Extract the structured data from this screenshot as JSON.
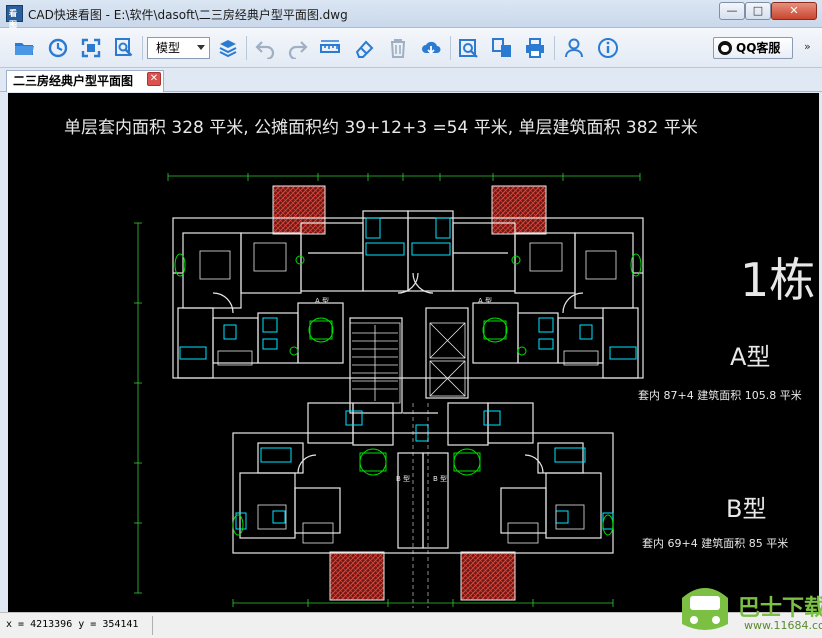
{
  "window": {
    "title": "CAD快速看图 - E:\\软件\\dasoft\\二三房经典户型平面图.dwg",
    "app_icon_text": "看图",
    "minimize": "—",
    "maximize": "□",
    "close": "✕"
  },
  "toolbar": {
    "mode_select": "模型",
    "qq_label": "QQ客服",
    "more": "»",
    "icon_color": "#2b7bd3"
  },
  "tab": {
    "label": "二三房经典户型平面图",
    "close": "✕"
  },
  "drawing": {
    "header": "单层套内面积 328  平米,  公摊面积约 39+12+3  =54 平米,   单层建筑面积 382 平米",
    "building_no": "1栋",
    "type_a": "A型",
    "type_a_area": "套内 87+4  建筑面积 105.8  平米",
    "type_b": "B型",
    "type_b_area": "套内 69+4  建筑面积 85  平米",
    "unit_label_a": "A 型",
    "unit_label_b": "B 型",
    "line_color": "#e8e8e8",
    "hatch_color": "#c8352e",
    "fixture_color": "#00e5ff",
    "plant_color": "#00e000",
    "dim_color": "#33cc33"
  },
  "status": {
    "coords": "x = 4213396 y = 354141"
  },
  "watermark": {
    "name": "巴士下载",
    "url": "www.11684.com",
    "color": "#7bc043"
  }
}
